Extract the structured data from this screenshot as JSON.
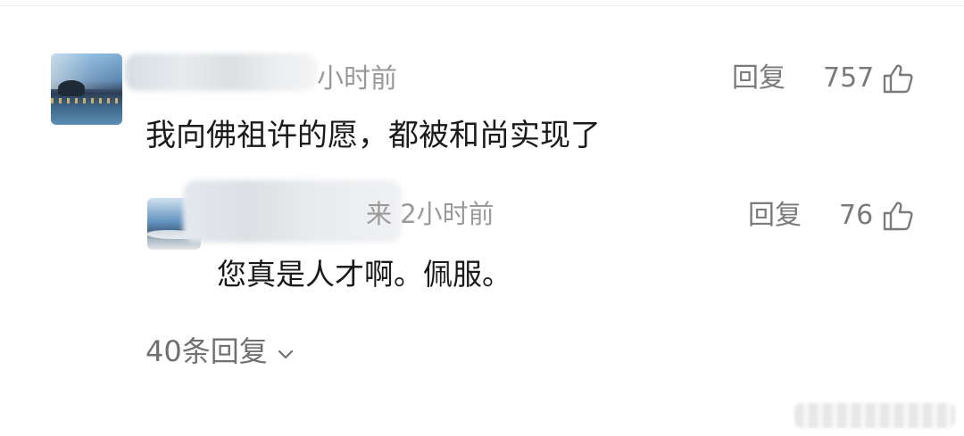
{
  "comment": {
    "time_fragment": "小时前",
    "reply_label": "回复",
    "like_count": "757",
    "text": "我向佛祖许的愿，都被和尚实现了"
  },
  "reply": {
    "time_fragment": "来 2小时前",
    "reply_label": "回复",
    "like_count": "76",
    "text": "您真是人才啊。佩服。"
  },
  "footer": {
    "view_replies_label": "40条回复"
  },
  "icons": {
    "like": "thumbs-up-icon",
    "expand": "chevron-down-icon"
  },
  "colors": {
    "text_primary": "#1a1a1a",
    "text_secondary": "#7a7a7a",
    "text_muted": "#9a9a9a"
  }
}
